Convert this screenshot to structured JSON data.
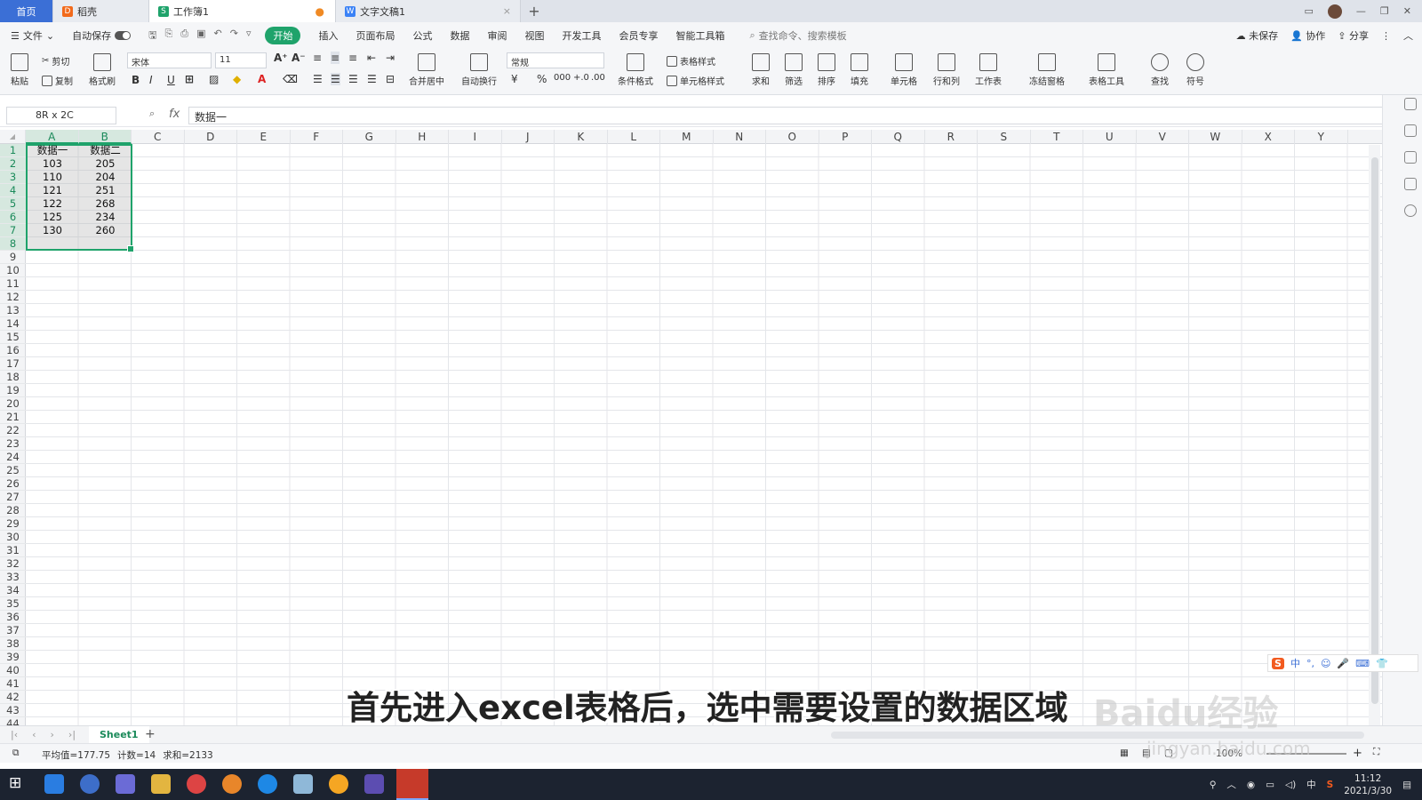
{
  "tabs": {
    "home": "首页",
    "doc1": "稻壳",
    "doc2": "工作簿1",
    "doc3": "文字文稿1"
  },
  "menu": {
    "file": "文件",
    "autosave": "自动保存",
    "items": [
      "开始",
      "插入",
      "页面布局",
      "公式",
      "数据",
      "审阅",
      "视图",
      "开发工具",
      "会员专享",
      "智能工具箱"
    ],
    "active": "开始",
    "search": "查找命令、搜索模板",
    "unsaved": "未保存",
    "collab": "协作",
    "share": "分享"
  },
  "ribbon": {
    "paste": "粘贴",
    "cut": "剪切",
    "copy": "复制",
    "format_painter": "格式刷",
    "font": "宋体",
    "size": "11",
    "merge": "合并居中",
    "wrap": "自动换行",
    "numfmt": "常规",
    "cond": "条件格式",
    "table_style": "表格样式",
    "cell_style": "单元格样式",
    "sum": "求和",
    "filter": "筛选",
    "sort": "排序",
    "fill": "填充",
    "cell": "单元格",
    "rowcol": "行和列",
    "sheet": "工作表",
    "freeze": "冻结窗格",
    "tools": "表格工具",
    "find": "查找",
    "symbol": "符号"
  },
  "formula": {
    "namebox": "8R x 2C",
    "fx": "fx",
    "content": "数据一"
  },
  "columns": [
    "A",
    "B",
    "C",
    "D",
    "E",
    "F",
    "G",
    "H",
    "I",
    "J",
    "K",
    "L",
    "M",
    "N",
    "O",
    "P",
    "Q",
    "R",
    "S",
    "T",
    "U",
    "V",
    "W",
    "X",
    "Y"
  ],
  "rows": [
    "1",
    "2",
    "3",
    "4",
    "5",
    "6",
    "7",
    "8",
    "9",
    "10",
    "11",
    "12",
    "13",
    "14",
    "15",
    "16",
    "17",
    "18",
    "19",
    "20",
    "21",
    "22",
    "23",
    "24",
    "25",
    "26",
    "27",
    "28",
    "29",
    "30",
    "31",
    "32",
    "33",
    "34",
    "35",
    "36",
    "37",
    "38",
    "39",
    "40",
    "41",
    "42",
    "43",
    "44"
  ],
  "table": {
    "headers": [
      "数据一",
      "数据二"
    ],
    "rows": [
      [
        "103",
        "205"
      ],
      [
        "110",
        "204"
      ],
      [
        "121",
        "251"
      ],
      [
        "122",
        "268"
      ],
      [
        "125",
        "234"
      ],
      [
        "130",
        "260"
      ]
    ]
  },
  "sheet": {
    "name": "Sheet1"
  },
  "status": {
    "avg": "平均值=177.75",
    "count": "计数=14",
    "sum": "求和=2133",
    "zoom": "100%"
  },
  "subtitle": "首先进入excel表格后，选中需要设置的数据区域",
  "watermark": "Baidu经验",
  "watermark_url": "jingyan.baidu.com",
  "ime": {
    "logo": "S",
    "lang": "中"
  },
  "taskbar": {
    "lang": "中",
    "time": "11:12",
    "date": "2021/3/30"
  },
  "colors": {
    "accent": "#1fa36b",
    "home_tab": "#3b6fd6"
  }
}
